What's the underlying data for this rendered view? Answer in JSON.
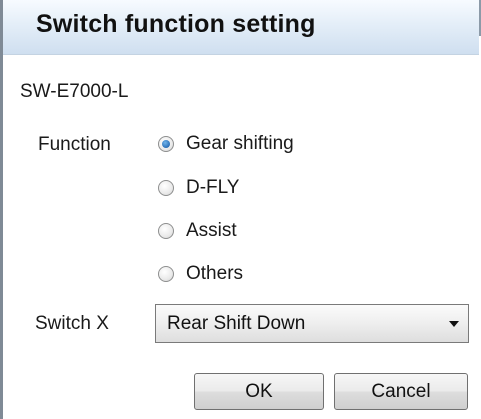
{
  "window": {
    "title": "Switch function setting"
  },
  "device": {
    "name": "SW-E7000-L"
  },
  "function": {
    "label": "Function",
    "selected": "Gear shifting",
    "options": [
      "Gear shifting",
      "D-FLY",
      "Assist",
      "Others"
    ]
  },
  "switch_x": {
    "label": "Switch X",
    "value": "Rear Shift Down"
  },
  "buttons": {
    "ok": "OK",
    "cancel": "Cancel"
  },
  "colors": {
    "titlebar_top": "#f7fbff",
    "titlebar_bottom": "#cfdff0",
    "radio_checked": "#2a6fb8"
  },
  "icons": {
    "radio": "radio-button-icon",
    "dropdown": "chevron-down-icon"
  }
}
